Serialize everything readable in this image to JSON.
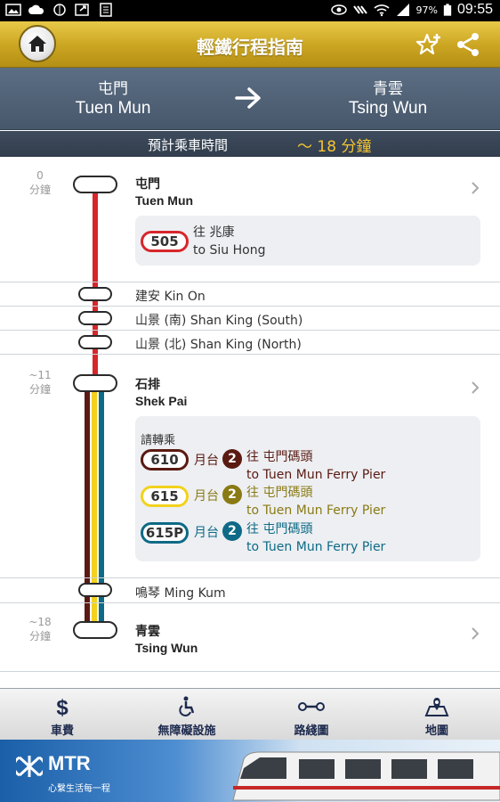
{
  "status_bar": {
    "battery": "97%",
    "time": "09:55"
  },
  "header": {
    "title": "輕鐵行程指南"
  },
  "route": {
    "from": {
      "zh": "屯門",
      "en": "Tuen Mun"
    },
    "to": {
      "zh": "青雲",
      "en": "Tsing Wun"
    }
  },
  "trip_time": {
    "label": "預計乘車時間",
    "value": "～ 18 分鐘"
  },
  "stops": {
    "tuen_mun": {
      "minutes_num": "0",
      "minutes_unit": "分鐘",
      "zh": "屯門",
      "en": "Tuen Mun",
      "bus": {
        "route": "505",
        "dest_zh": "往 兆康",
        "dest_en": "to Siu Hong"
      }
    },
    "kin_on": {
      "label": "建安 Kin On"
    },
    "shan_king_south": {
      "label": "山景 (南) Shan King (South)"
    },
    "shan_king_north": {
      "label": "山景 (北)  Shan King (North)"
    },
    "shek_pai": {
      "minutes_num": "~11",
      "minutes_unit": "分鐘",
      "zh": "石排",
      "en": "Shek Pai",
      "transfer_label": "請轉乘",
      "transfers": [
        {
          "route": "610",
          "platform_label": "月台",
          "platform": "2",
          "dest_zh": "往 屯門碼頭",
          "dest_en": "to Tuen Mun Ferry Pier",
          "color": "#5a1a12"
        },
        {
          "route": "615",
          "platform_label": "月台",
          "platform": "2",
          "dest_zh": "往 屯門碼頭",
          "dest_en": "to Tuen Mun Ferry Pier",
          "color": "#8a7a14"
        },
        {
          "route": "615P",
          "platform_label": "月台",
          "platform": "2",
          "dest_zh": "往 屯門碼頭",
          "dest_en": "to Tuen Mun Ferry Pier",
          "color": "#0e6a86"
        }
      ]
    },
    "ming_kum": {
      "label": "鳴琴 Ming Kum"
    },
    "tsing_wun": {
      "minutes_num": "~18",
      "minutes_unit": "分鐘",
      "zh": "青雲",
      "en": "Tsing Wun"
    }
  },
  "bottom_nav": {
    "fare": "車費",
    "accessibility": "無障礙設施",
    "route_map": "路綫圖",
    "map": "地圖"
  },
  "banner": {
    "brand": "MTR",
    "slogan": "心繫生活每一程"
  },
  "colors": {
    "header_gold": "#caa421",
    "route_bar": "#4f5f74",
    "time_value": "#f4c430",
    "line_505": "#d7262b",
    "line_610": "#5a1a12",
    "line_615": "#f2d21c",
    "line_615P": "#0e6a86"
  }
}
